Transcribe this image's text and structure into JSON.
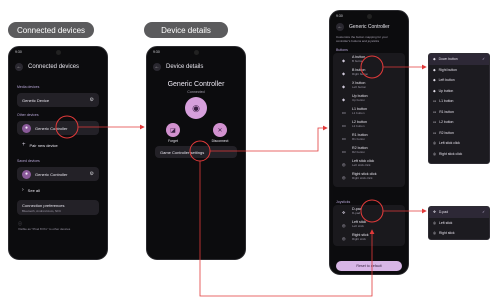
{
  "labels": {
    "connected_devices": "Connected devices",
    "device_details": "Device details",
    "label_color": "#5b5b5d"
  },
  "phone1": {
    "time": "9:30",
    "title": "Connected devices",
    "media_section": "Media devices",
    "media_device": "Genetic Device",
    "other_section": "Other devices",
    "other_device": "Generic Controller",
    "pair_label": "Pair new device",
    "saved_section": "Saved devices",
    "saved_device": "Generic Controller",
    "see_all": "See all",
    "prefs_title": "Connection preferences",
    "prefs_sub": "Bluetooth, Android Auto, NFC",
    "visible_note": "Visible as \"Pixel 8 Pro\" to other devices"
  },
  "phone2": {
    "time": "9:30",
    "title": "Device details",
    "device_name": "Generic Controller",
    "device_status": "Connected",
    "forget_label": "Forget",
    "disconnect_label": "Disconnect",
    "settings_link": "Game Controller settings"
  },
  "phone3": {
    "time": "9:30",
    "title": "Generic Controller",
    "desc": "Customize the button mapping for your controller's buttons and joysticks",
    "buttons_section": "Buttons",
    "rows": [
      {
        "name": "A button",
        "sub": "B button"
      },
      {
        "name": "B button",
        "sub": "Right button"
      },
      {
        "name": "X button",
        "sub": "Left button"
      },
      {
        "name": "Up button",
        "sub": "Up button"
      },
      {
        "name": "L1 button",
        "sub": "L1 button"
      },
      {
        "name": "L2 button",
        "sub": "L2 button"
      },
      {
        "name": "R1 button",
        "sub": "R1 button"
      },
      {
        "name": "R2 button",
        "sub": "R2 button"
      },
      {
        "name": "Left stick click",
        "sub": "Left stick click"
      },
      {
        "name": "Right stick click",
        "sub": "Right stick click"
      }
    ],
    "joystick_section": "Joysticks",
    "joy_rows": [
      {
        "name": "D-pad",
        "sub": "D-pad"
      },
      {
        "name": "Left stick",
        "sub": "Left stick"
      },
      {
        "name": "Right stick",
        "sub": "Right stick"
      }
    ],
    "reset_label": "Reset to default"
  },
  "dropdown1": {
    "items": [
      "Down button",
      "Right button",
      "Left button",
      "Up button",
      "L1 button",
      "R1 button",
      "L2 button",
      "R2 button",
      "Left stick click",
      "Right stick click"
    ],
    "selected_index": 0
  },
  "dropdown2": {
    "items": [
      "D-pad",
      "Left stick",
      "Right stick"
    ],
    "selected_index": 0
  }
}
